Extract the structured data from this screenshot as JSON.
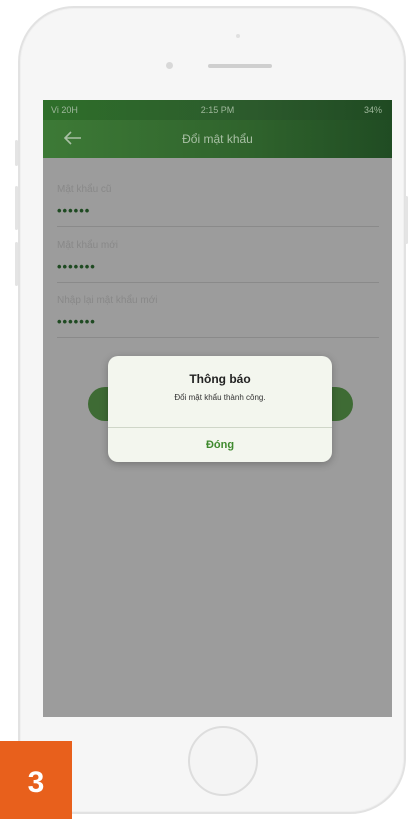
{
  "status_bar": {
    "carrier": "Vi 20H",
    "time": "2:15 PM",
    "battery": "34%"
  },
  "app_bar": {
    "title": "Đổi mật khẩu",
    "back_icon": "arrow-left-icon"
  },
  "form": {
    "fields": [
      {
        "label": "Mật khẩu cũ",
        "value": "••••••"
      },
      {
        "label": "Mật khẩu mới",
        "value": "•••••••"
      },
      {
        "label": "Nhập lại mật khẩu mới",
        "value": "•••••••"
      }
    ]
  },
  "dialog": {
    "title": "Thông báo",
    "message": "Đổi mật khẩu thành công.",
    "button_label": "Đóng"
  },
  "step_badge": {
    "number": "3"
  },
  "colors": {
    "accent_green": "#2f632c",
    "dialog_button": "#3f8a2e",
    "badge": "#e8601c"
  }
}
